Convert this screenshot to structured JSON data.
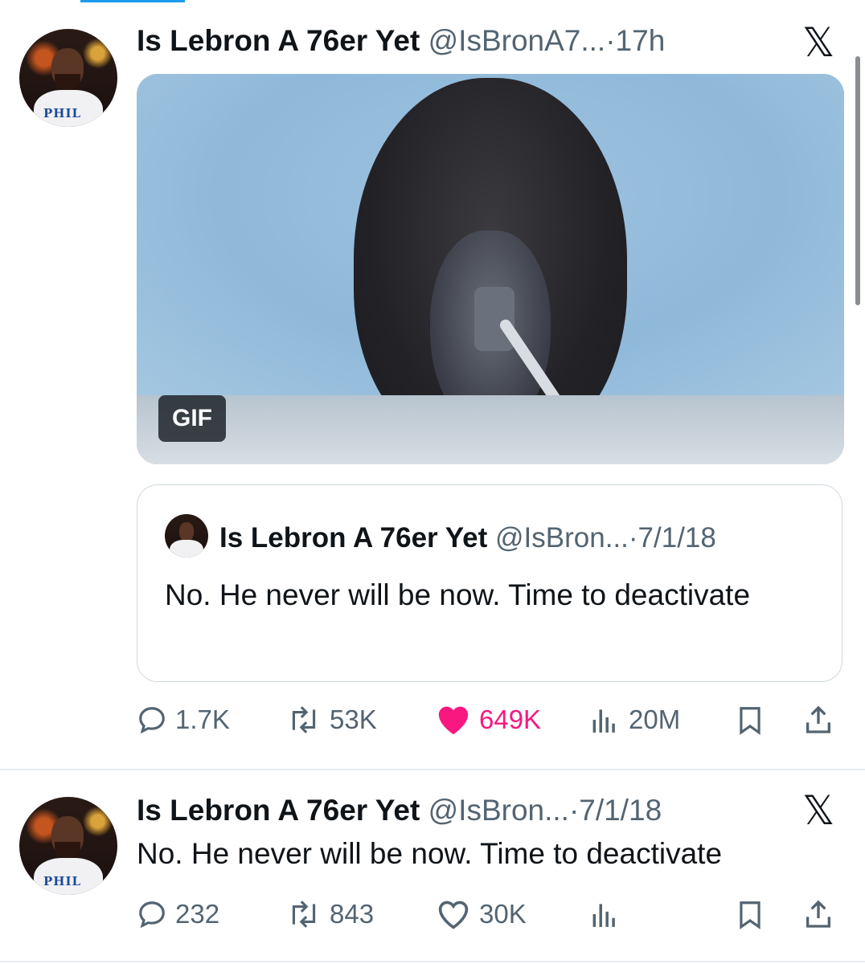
{
  "tweets": [
    {
      "display_name": "Is Lebron A 76er Yet",
      "handle": "@IsBronA7...",
      "separator": "·",
      "time": "17h",
      "avatar_jersey_text": "PHIL",
      "media_badge": "GIF",
      "quote": {
        "display_name": "Is Lebron A 76er Yet",
        "handle": "@IsBron...",
        "separator": "·",
        "time": "7/1/18",
        "text": "No. He never will be now. Time to deactivate"
      },
      "actions": {
        "replies": "1.7K",
        "reposts": "53K",
        "likes": "649K",
        "views": "20M"
      }
    },
    {
      "display_name": "Is Lebron A 76er Yet",
      "handle": "@IsBron...",
      "separator": "·",
      "time": "7/1/18",
      "avatar_jersey_text": "PHIL",
      "text": "No. He never will be now. Time to deactivate",
      "actions": {
        "replies": "232",
        "reposts": "843",
        "likes": "30K"
      }
    }
  ],
  "brand_icon": "x-logo-icon",
  "colors": {
    "like": "#f91880",
    "muted": "#536471",
    "accent": "#1d9bf0"
  }
}
